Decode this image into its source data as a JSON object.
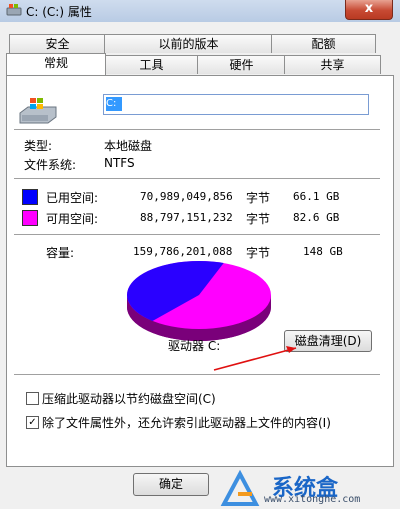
{
  "window": {
    "title": "C: (C:) 属性",
    "close_label": "x"
  },
  "tabs_row1": [
    {
      "label": "安全"
    },
    {
      "label": "以前的版本"
    },
    {
      "label": "配额"
    }
  ],
  "tabs_row2": [
    {
      "label": "常规",
      "active": true
    },
    {
      "label": "工具"
    },
    {
      "label": "硬件"
    },
    {
      "label": "共享"
    }
  ],
  "general": {
    "drive_name_value": "C:",
    "type_label": "类型:",
    "type_value": "本地磁盘",
    "fs_label": "文件系统:",
    "fs_value": "NTFS",
    "used": {
      "label": "已用空间:",
      "bytes": "70,989,049,856",
      "unit": "字节",
      "size": "66.1 GB",
      "color": "#0000ff"
    },
    "free": {
      "label": "可用空间:",
      "bytes": "88,797,151,232",
      "unit": "字节",
      "size": "82.6 GB",
      "color": "#ff00ff"
    },
    "capacity": {
      "label": "容量:",
      "bytes": "159,786,201,088",
      "unit": "字节",
      "size": "148 GB"
    },
    "drive_label": "驱动器 C:",
    "cleanup_button": "磁盘清理(D)",
    "compress_label": "压缩此驱动器以节约磁盘空间(C)",
    "compress_checked": false,
    "index_label": "除了文件属性外，还允许索引此驱动器上文件的内容(I)",
    "index_checked": true,
    "used_fraction": 0.444
  },
  "footer": {
    "ok_button": "确定"
  },
  "watermark": {
    "brand": "系统盒",
    "url": "www.xitonghe.com"
  }
}
